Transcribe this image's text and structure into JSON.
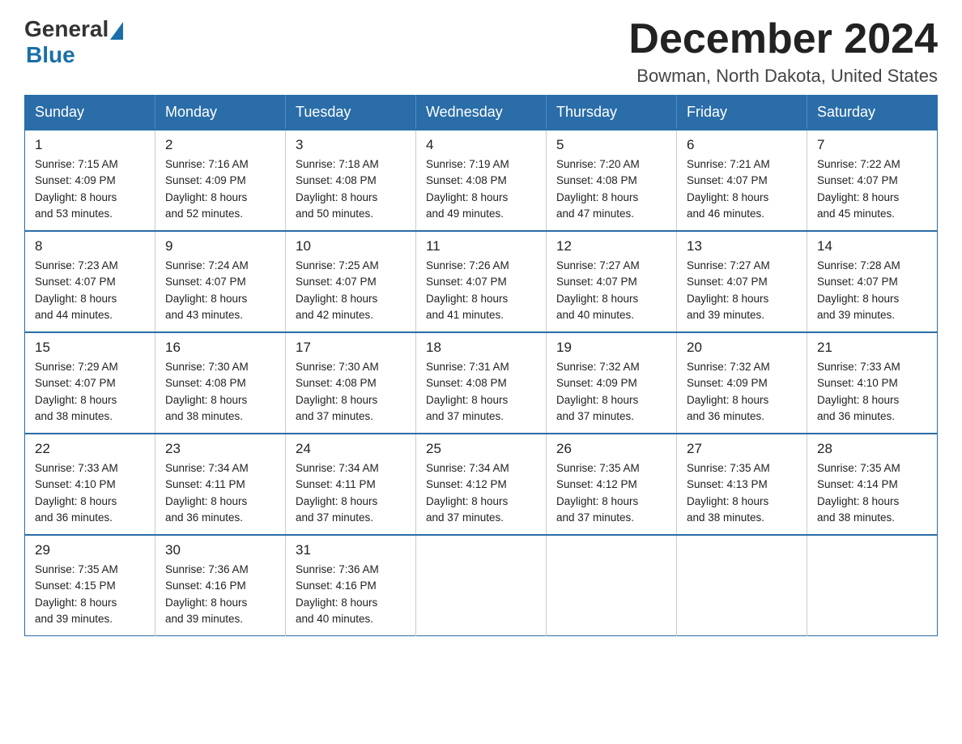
{
  "logo": {
    "general": "General",
    "blue": "Blue"
  },
  "title": "December 2024",
  "subtitle": "Bowman, North Dakota, United States",
  "weekdays": [
    "Sunday",
    "Monday",
    "Tuesday",
    "Wednesday",
    "Thursday",
    "Friday",
    "Saturday"
  ],
  "weeks": [
    [
      {
        "day": "1",
        "sunrise": "7:15 AM",
        "sunset": "4:09 PM",
        "daylight": "8 hours and 53 minutes."
      },
      {
        "day": "2",
        "sunrise": "7:16 AM",
        "sunset": "4:09 PM",
        "daylight": "8 hours and 52 minutes."
      },
      {
        "day": "3",
        "sunrise": "7:18 AM",
        "sunset": "4:08 PM",
        "daylight": "8 hours and 50 minutes."
      },
      {
        "day": "4",
        "sunrise": "7:19 AM",
        "sunset": "4:08 PM",
        "daylight": "8 hours and 49 minutes."
      },
      {
        "day": "5",
        "sunrise": "7:20 AM",
        "sunset": "4:08 PM",
        "daylight": "8 hours and 47 minutes."
      },
      {
        "day": "6",
        "sunrise": "7:21 AM",
        "sunset": "4:07 PM",
        "daylight": "8 hours and 46 minutes."
      },
      {
        "day": "7",
        "sunrise": "7:22 AM",
        "sunset": "4:07 PM",
        "daylight": "8 hours and 45 minutes."
      }
    ],
    [
      {
        "day": "8",
        "sunrise": "7:23 AM",
        "sunset": "4:07 PM",
        "daylight": "8 hours and 44 minutes."
      },
      {
        "day": "9",
        "sunrise": "7:24 AM",
        "sunset": "4:07 PM",
        "daylight": "8 hours and 43 minutes."
      },
      {
        "day": "10",
        "sunrise": "7:25 AM",
        "sunset": "4:07 PM",
        "daylight": "8 hours and 42 minutes."
      },
      {
        "day": "11",
        "sunrise": "7:26 AM",
        "sunset": "4:07 PM",
        "daylight": "8 hours and 41 minutes."
      },
      {
        "day": "12",
        "sunrise": "7:27 AM",
        "sunset": "4:07 PM",
        "daylight": "8 hours and 40 minutes."
      },
      {
        "day": "13",
        "sunrise": "7:27 AM",
        "sunset": "4:07 PM",
        "daylight": "8 hours and 39 minutes."
      },
      {
        "day": "14",
        "sunrise": "7:28 AM",
        "sunset": "4:07 PM",
        "daylight": "8 hours and 39 minutes."
      }
    ],
    [
      {
        "day": "15",
        "sunrise": "7:29 AM",
        "sunset": "4:07 PM",
        "daylight": "8 hours and 38 minutes."
      },
      {
        "day": "16",
        "sunrise": "7:30 AM",
        "sunset": "4:08 PM",
        "daylight": "8 hours and 38 minutes."
      },
      {
        "day": "17",
        "sunrise": "7:30 AM",
        "sunset": "4:08 PM",
        "daylight": "8 hours and 37 minutes."
      },
      {
        "day": "18",
        "sunrise": "7:31 AM",
        "sunset": "4:08 PM",
        "daylight": "8 hours and 37 minutes."
      },
      {
        "day": "19",
        "sunrise": "7:32 AM",
        "sunset": "4:09 PM",
        "daylight": "8 hours and 37 minutes."
      },
      {
        "day": "20",
        "sunrise": "7:32 AM",
        "sunset": "4:09 PM",
        "daylight": "8 hours and 36 minutes."
      },
      {
        "day": "21",
        "sunrise": "7:33 AM",
        "sunset": "4:10 PM",
        "daylight": "8 hours and 36 minutes."
      }
    ],
    [
      {
        "day": "22",
        "sunrise": "7:33 AM",
        "sunset": "4:10 PM",
        "daylight": "8 hours and 36 minutes."
      },
      {
        "day": "23",
        "sunrise": "7:34 AM",
        "sunset": "4:11 PM",
        "daylight": "8 hours and 36 minutes."
      },
      {
        "day": "24",
        "sunrise": "7:34 AM",
        "sunset": "4:11 PM",
        "daylight": "8 hours and 37 minutes."
      },
      {
        "day": "25",
        "sunrise": "7:34 AM",
        "sunset": "4:12 PM",
        "daylight": "8 hours and 37 minutes."
      },
      {
        "day": "26",
        "sunrise": "7:35 AM",
        "sunset": "4:12 PM",
        "daylight": "8 hours and 37 minutes."
      },
      {
        "day": "27",
        "sunrise": "7:35 AM",
        "sunset": "4:13 PM",
        "daylight": "8 hours and 38 minutes."
      },
      {
        "day": "28",
        "sunrise": "7:35 AM",
        "sunset": "4:14 PM",
        "daylight": "8 hours and 38 minutes."
      }
    ],
    [
      {
        "day": "29",
        "sunrise": "7:35 AM",
        "sunset": "4:15 PM",
        "daylight": "8 hours and 39 minutes."
      },
      {
        "day": "30",
        "sunrise": "7:36 AM",
        "sunset": "4:16 PM",
        "daylight": "8 hours and 39 minutes."
      },
      {
        "day": "31",
        "sunrise": "7:36 AM",
        "sunset": "4:16 PM",
        "daylight": "8 hours and 40 minutes."
      },
      null,
      null,
      null,
      null
    ]
  ]
}
